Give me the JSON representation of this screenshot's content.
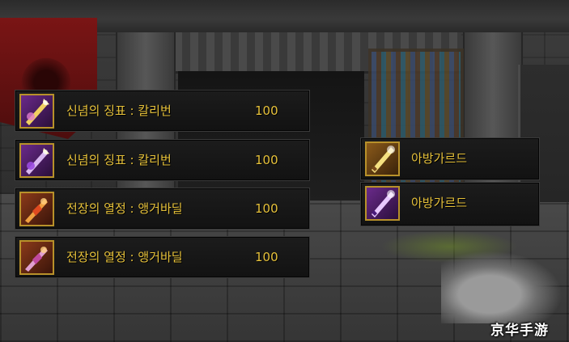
{
  "items_left": [
    {
      "name": "신념의 징표 : 칼리번",
      "quantity": "100",
      "icon": "sword-sigil-icon",
      "icon_color": "purple"
    },
    {
      "name": "신념의 징표 : 칼리번",
      "quantity": "100",
      "icon": "sword-sigil-icon",
      "icon_color": "purple"
    },
    {
      "name": "전장의 열정 : 앵거바딜",
      "quantity": "100",
      "icon": "flame-blade-icon",
      "icon_color": "red"
    },
    {
      "name": "전장의 열정 : 앵거바딜",
      "quantity": "100",
      "icon": "flame-blade-icon",
      "icon_color": "red"
    }
  ],
  "items_right": [
    {
      "name": "아방가르드",
      "icon": "glowing-sword-icon",
      "icon_color": "gold"
    },
    {
      "name": "아방가르드",
      "icon": "glowing-sword-icon",
      "icon_color": "purple"
    }
  ],
  "watermark": "京华手游",
  "colors": {
    "item_text": "#e6c13a",
    "icon_border": "#b8912a",
    "row_bg": "#161616"
  }
}
